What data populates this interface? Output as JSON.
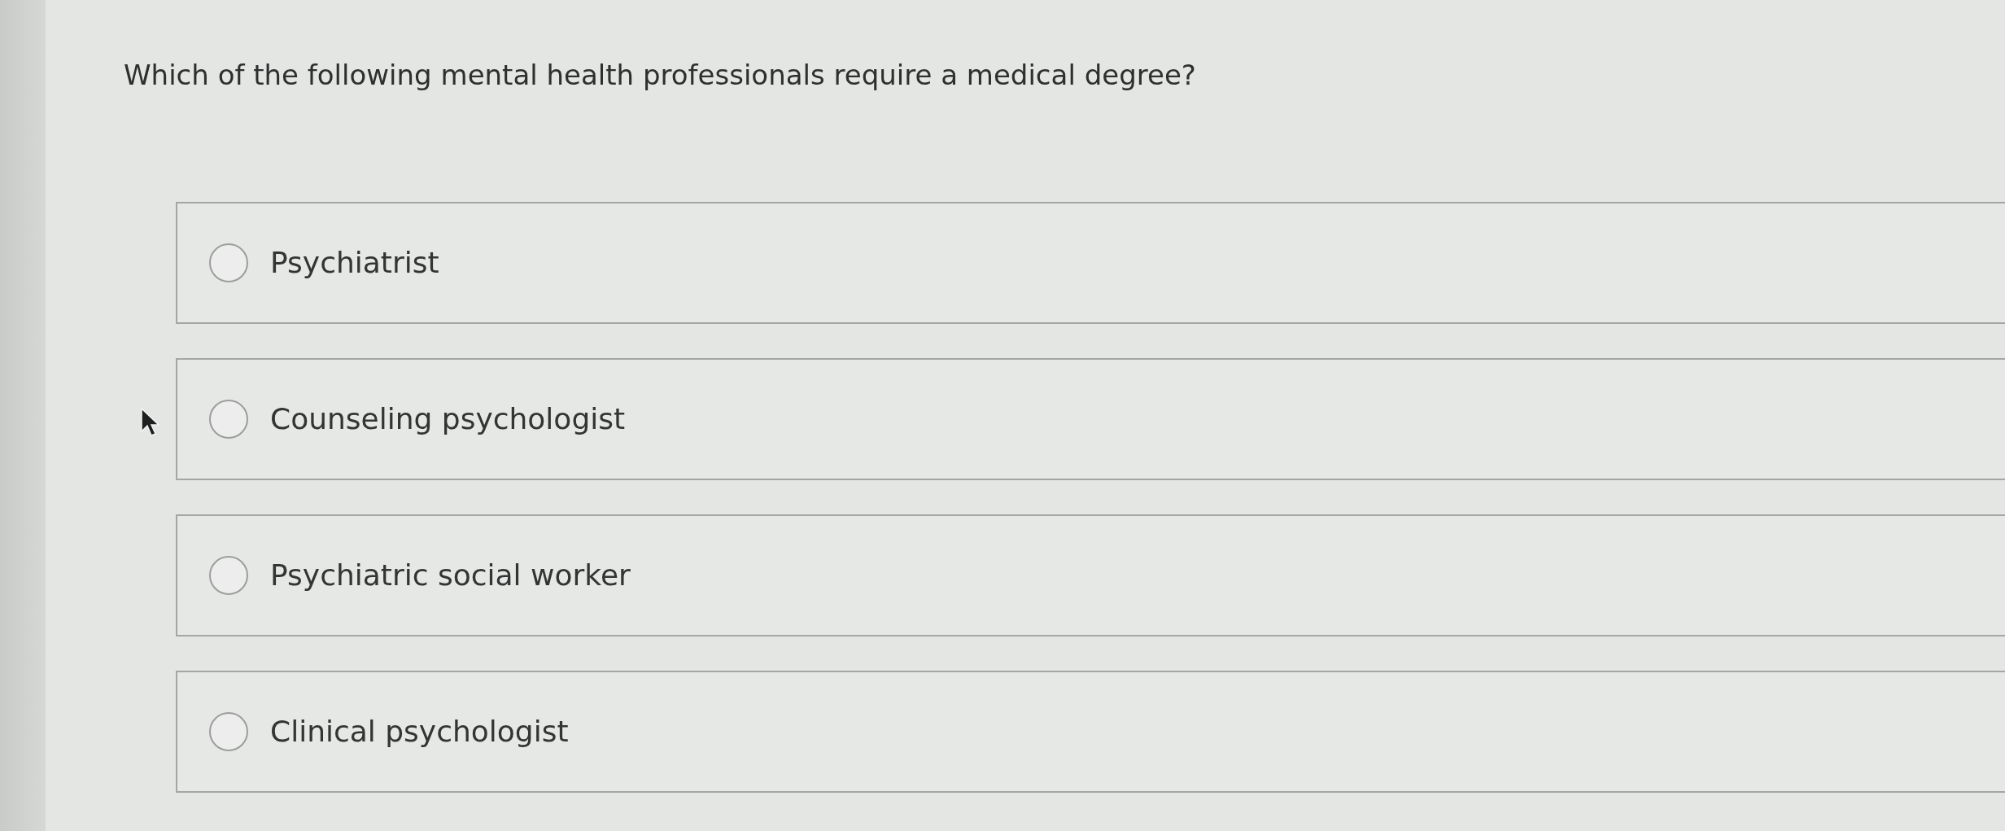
{
  "question": "Which of the following mental health professionals require a medical degree?",
  "options": [
    {
      "label": "Psychiatrist",
      "selected": false
    },
    {
      "label": "Counseling psychologist",
      "selected": false
    },
    {
      "label": "Psychiatric social worker",
      "selected": false
    },
    {
      "label": "Clinical psychologist",
      "selected": false
    }
  ]
}
